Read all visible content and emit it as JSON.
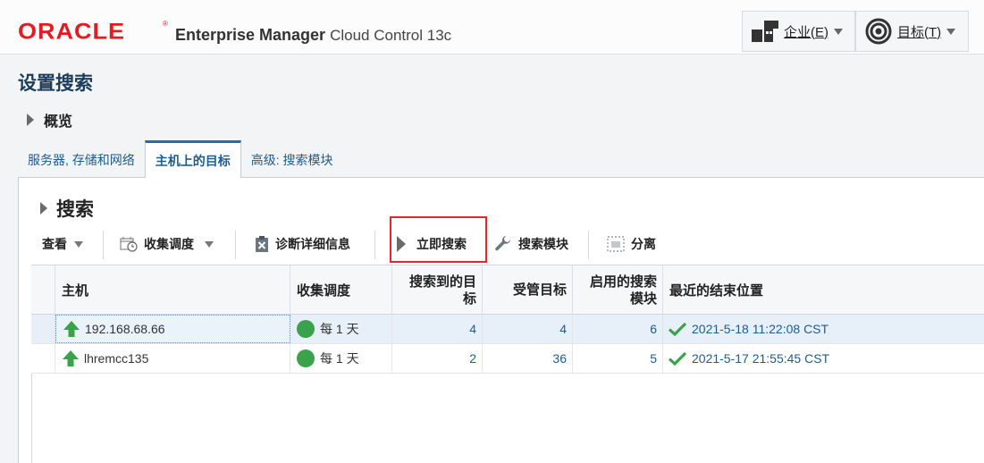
{
  "header": {
    "brand": "ORACLE",
    "product_bold": "Enterprise Manager",
    "product_light": "Cloud Control 13c",
    "enterprise_menu": "企业(E)",
    "targets_menu": "目标(T)"
  },
  "page": {
    "title": "设置搜索",
    "overview": "概览"
  },
  "tabs": [
    {
      "label": "服务器, 存储和网络"
    },
    {
      "label": "主机上的目标"
    },
    {
      "label": "高级: 搜索模块"
    }
  ],
  "section": {
    "title": "搜索"
  },
  "toolbar": {
    "view": "查看",
    "collection_schedule": "收集调度",
    "diagnostics": "诊断详细信息",
    "search_now": "立即搜索",
    "search_modules": "搜索模块",
    "detach": "分离"
  },
  "table": {
    "columns": [
      "主机",
      "收集调度",
      "搜索到的目标",
      "受管目标",
      "启用的搜索模块",
      "最近的结束位置"
    ],
    "rows": [
      {
        "host": "192.168.68.66",
        "schedule": "每 1 天",
        "found": "4",
        "managed": "4",
        "modules": "6",
        "last_end": "2021-5-18 11:22:08 CST"
      },
      {
        "host": "lhremcc135",
        "schedule": "每 1 天",
        "found": "2",
        "managed": "36",
        "modules": "5",
        "last_end": "2021-5-17 21:55:45 CST"
      }
    ]
  },
  "colors": {
    "oracle_red": "#e31b23",
    "link_blue": "#1f5b8c",
    "status_green": "#3aa24a",
    "highlight_red": "#e0282e"
  }
}
